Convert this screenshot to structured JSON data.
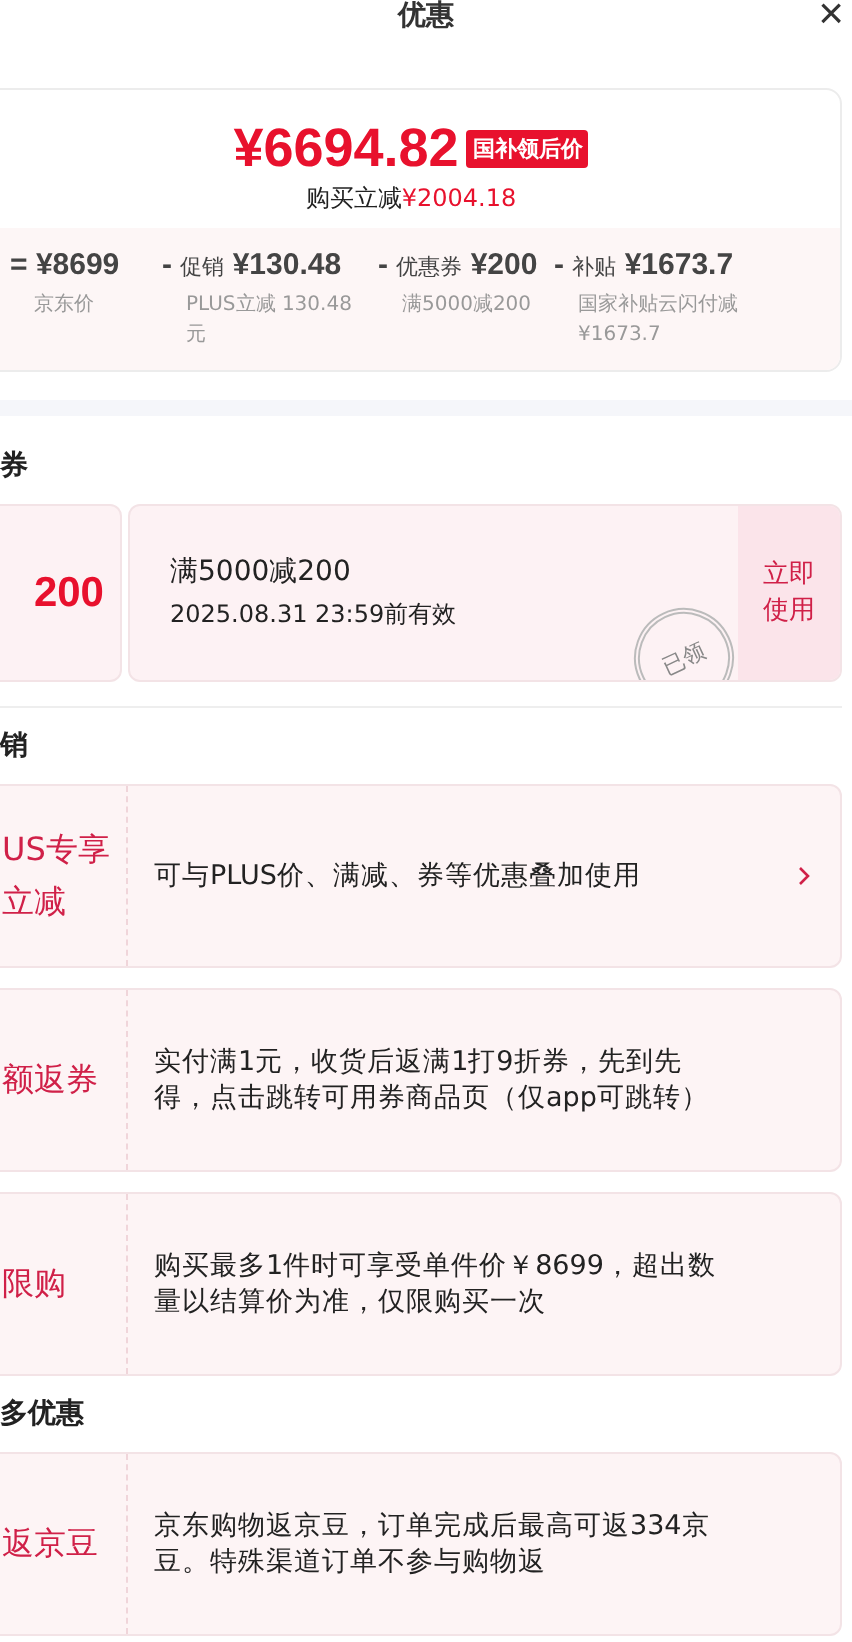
{
  "header": {
    "title": "优惠",
    "close": "×"
  },
  "summary": {
    "price": "¥6694.82",
    "price_tag": "国补领后价",
    "saving_label": "购买立减",
    "saving_amount": "¥2004.18",
    "breakdown": [
      {
        "op": "=",
        "amount": "¥8699",
        "note": "京东价"
      },
      {
        "op": "-",
        "label": "促销",
        "amount": "¥130.48",
        "note": "PLUS立减 130.48元"
      },
      {
        "op": "-",
        "label": "优惠券",
        "amount": "¥200",
        "note": "满5000减200"
      },
      {
        "op": "-",
        "label": "补贴",
        "amount": "¥1673.7",
        "note": "国家补贴云闪付减¥1673.7"
      }
    ]
  },
  "coupon_section": {
    "title": "券",
    "coupons": [
      {
        "amount": "200",
        "condition": "满5000减200",
        "validity": "2025.08.31 23:59前有效",
        "stamp": "已领",
        "action": "立即使用"
      }
    ]
  },
  "promo_section": {
    "title": "销",
    "items": [
      {
        "tag": "US专享立减",
        "text": "可与PLUS价、满减、券等优惠叠加使用",
        "arrow": true
      },
      {
        "tag": "额返券",
        "text": "实付满1元，收货后返满1打9折券，先到先得，点击跳转可用券商品页（仅app可跳转）",
        "arrow": false
      },
      {
        "tag": "限购",
        "text": "购买最多1件时可享受单件价￥8699，超出数量以结算价为准，仅限购买一次",
        "arrow": false
      }
    ]
  },
  "more_section": {
    "title": "多优惠",
    "items": [
      {
        "tag": "返京豆",
        "text": "京东购物返京豆，订单完成后最高可返334京豆。特殊渠道订单不参与购物返",
        "arrow": false
      }
    ]
  }
}
